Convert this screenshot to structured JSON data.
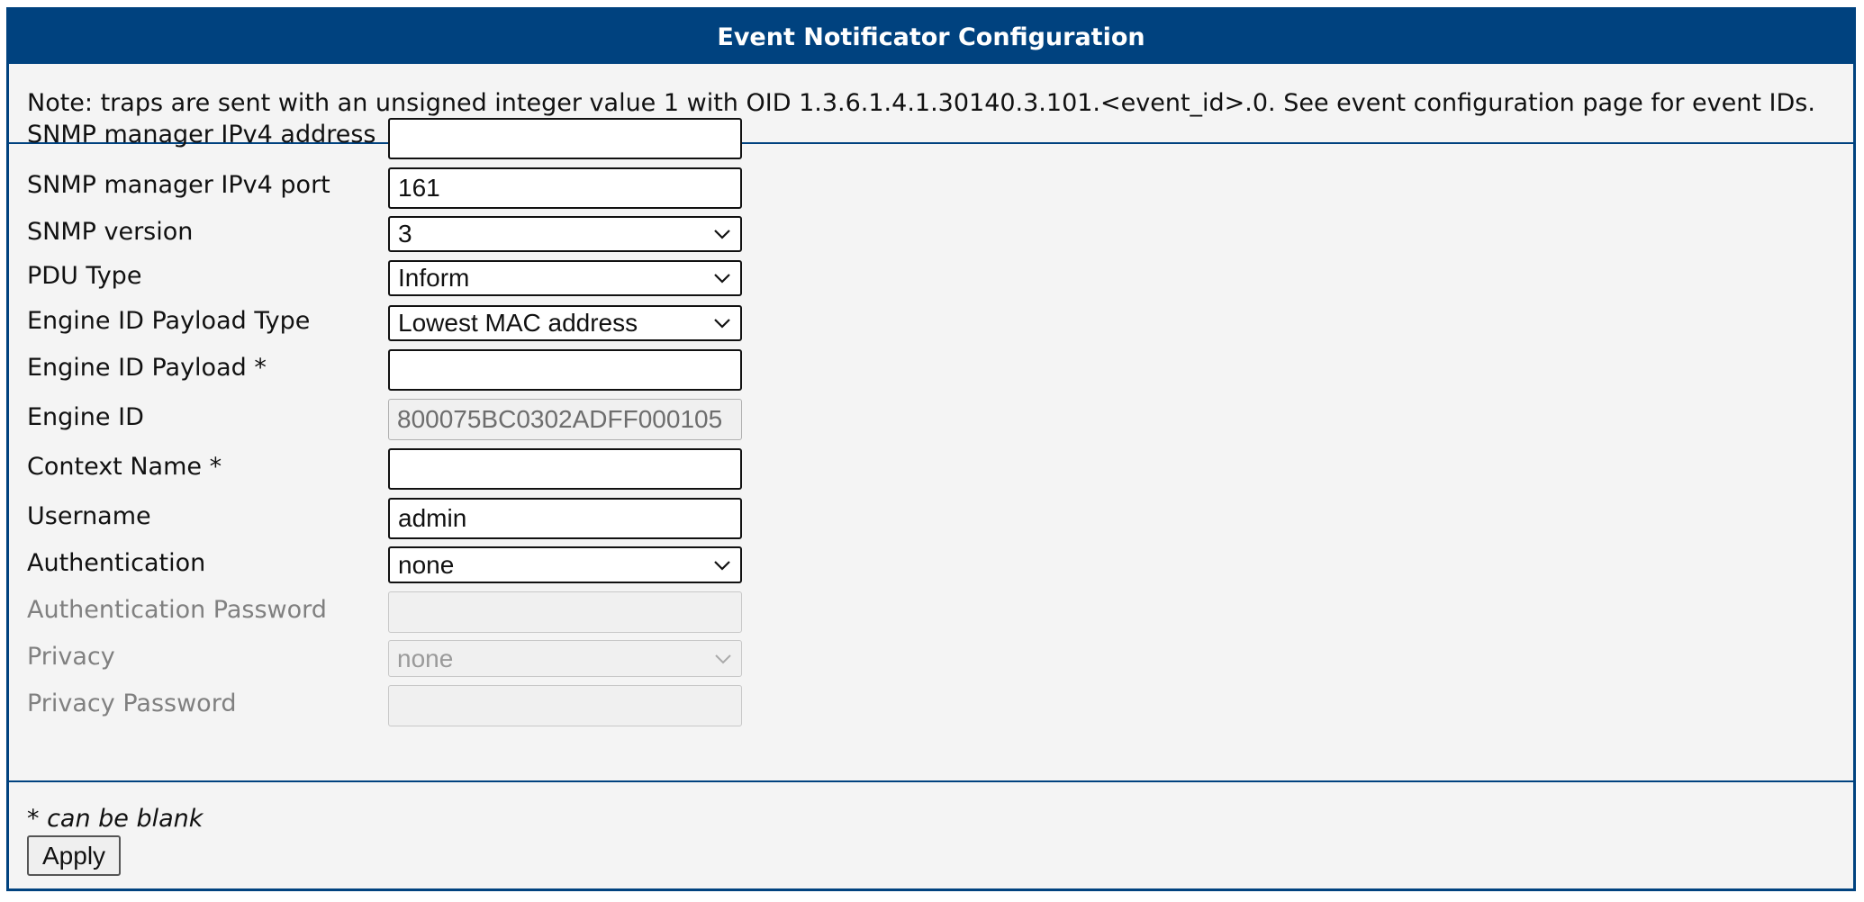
{
  "header": {
    "title": "Event Notificator Configuration"
  },
  "note": "Note: traps are sent with an unsigned integer value 1 with OID 1.3.6.1.4.1.30140.3.101.<event_id>.0. See event configuration page for event IDs.",
  "form": {
    "snmp_address": {
      "label": "SNMP manager IPv4 address",
      "value": ""
    },
    "snmp_port": {
      "label": "SNMP manager IPv4 port",
      "value": "161"
    },
    "snmp_version": {
      "label": "SNMP version",
      "value": "3"
    },
    "pdu_type": {
      "label": "PDU Type",
      "value": "Inform"
    },
    "engine_id_payload_type": {
      "label": "Engine ID Payload Type",
      "value": "Lowest MAC address"
    },
    "engine_id_payload": {
      "label": "Engine ID Payload *",
      "value": ""
    },
    "engine_id": {
      "label": "Engine ID",
      "value": "800075BC0302ADFF000105"
    },
    "context_name": {
      "label": "Context Name *",
      "value": ""
    },
    "username": {
      "label": "Username",
      "value": "admin"
    },
    "authentication": {
      "label": "Authentication",
      "value": "none"
    },
    "auth_password": {
      "label": "Authentication Password",
      "value": ""
    },
    "privacy": {
      "label": "Privacy",
      "value": "none"
    },
    "privacy_password": {
      "label": "Privacy Password",
      "value": ""
    }
  },
  "footer": {
    "hint_star": "*",
    "hint_text": " can be blank",
    "apply_label": "Apply"
  },
  "colors": {
    "accent": "#00427f",
    "panel_bg": "#f4f4f4"
  },
  "icons": {
    "dropdown": "chevron-down-icon"
  }
}
